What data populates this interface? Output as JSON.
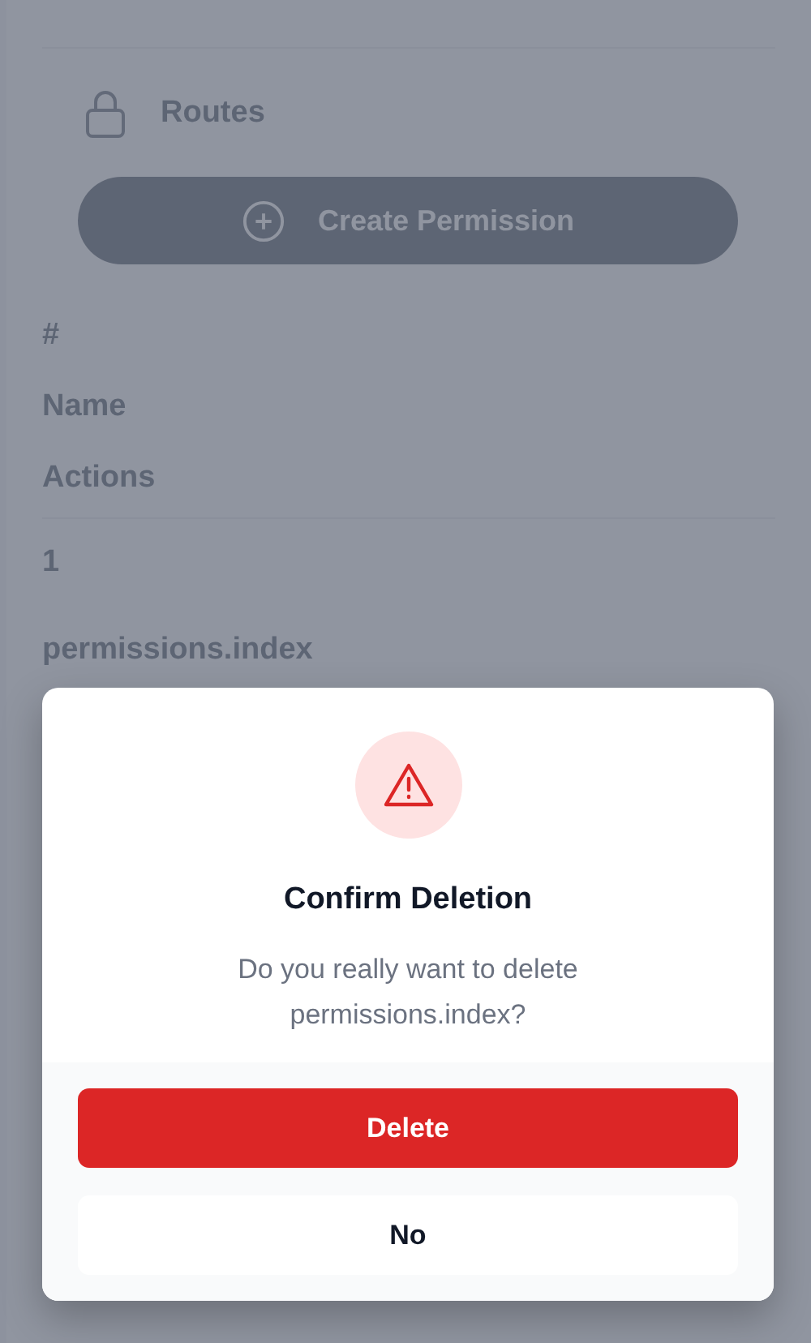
{
  "nav": {
    "label": "Routes"
  },
  "create_button": {
    "label": "Create Permission"
  },
  "table": {
    "columns": [
      "#",
      "Name",
      "Actions"
    ],
    "rows": [
      {
        "cells": [
          "1",
          "permissions.index"
        ]
      }
    ]
  },
  "dialog": {
    "title": "Confirm Deletion",
    "message": "Do you really want to delete permissions.index?",
    "buttons": [
      {
        "label": "Delete",
        "kind": "danger"
      },
      {
        "label": "No",
        "kind": "plain"
      }
    ]
  }
}
